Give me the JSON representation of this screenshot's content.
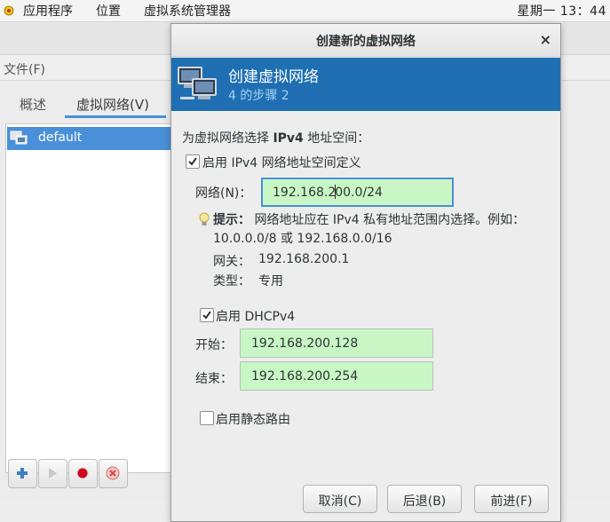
{
  "topbar": {
    "apps_label": "应用程序",
    "places_label": "位置",
    "app_label": "虚拟系统管理器",
    "clock": "星期一 13：44"
  },
  "main_window": {
    "menu_file": "文件(F)",
    "tabs": [
      {
        "label": "概述",
        "active": false
      },
      {
        "label": "虚拟网络(V)",
        "active": true
      }
    ],
    "networks": [
      {
        "name": "default",
        "selected": true
      }
    ],
    "bottom_buttons": [
      {
        "icon": "add-icon"
      },
      {
        "icon": "play-icon"
      },
      {
        "icon": "stop-record-icon"
      },
      {
        "icon": "delete-icon"
      }
    ]
  },
  "dialog": {
    "title": "创建新的虚拟网络",
    "close_glyph": "×",
    "banner": {
      "title": "创建虚拟网络",
      "step": "4 的步骤 2",
      "color": "#1f6fb2"
    },
    "section_prefix": "为虚拟网络选择 ",
    "section_bold": "IPv4",
    "section_suffix": " 地址空间：",
    "enable_ipv4": {
      "label": "启用  IPv4 网络地址空间定义",
      "checked": true
    },
    "network": {
      "label": "网络(N)：",
      "value_before_caret": "192.168.2",
      "value_after_caret": "00.0/24"
    },
    "hint": {
      "bold": "提示：",
      "line1": " 网络地址应在 IPv4 私有地址范围内选择。例如：",
      "line2": "10.0.0.0/8 或 192.168.0.0/16"
    },
    "gateway": {
      "label": "网关：",
      "value": "192.168.200.1"
    },
    "type": {
      "label": "类型：",
      "value": "专用"
    },
    "dhcp": {
      "label": "启用  DHCPv4",
      "checked": true
    },
    "start": {
      "label": "开始：",
      "value": "192.168.200.128"
    },
    "end": {
      "label": "结束：",
      "value": "192.168.200.254"
    },
    "static_route": {
      "label": "启用静态路由",
      "checked": false
    },
    "buttons": {
      "cancel": "取消(C)",
      "back": "后退(B)",
      "forward": "前进(F)"
    },
    "field_valid_color": "#c8f7c5"
  }
}
